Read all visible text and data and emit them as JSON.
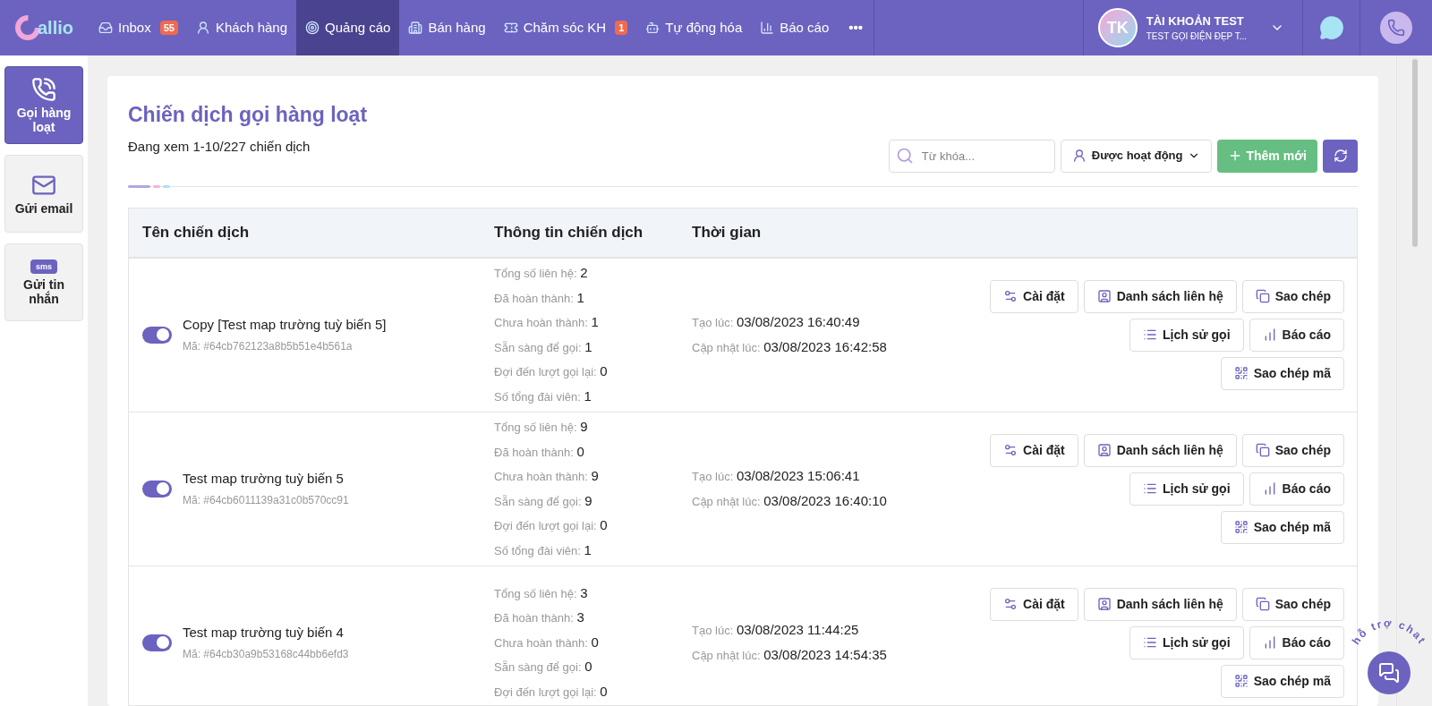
{
  "nav": {
    "logo": "allio",
    "items": [
      {
        "label": "Inbox",
        "badge": "55",
        "selected": false
      },
      {
        "label": "Khách hàng",
        "selected": false
      },
      {
        "label": "Quảng cáo",
        "selected": true
      },
      {
        "label": "Bán hàng",
        "selected": false
      },
      {
        "label": "Chăm sóc KH",
        "badge": "1",
        "selected": false
      },
      {
        "label": "Tự động hóa",
        "selected": false
      },
      {
        "label": "Báo cáo",
        "selected": false
      }
    ],
    "more": "•••",
    "account": {
      "initials": "TK",
      "name": "TÀI KHOẢN TEST",
      "subtitle": "TEST GỌI ĐIỆN ĐẸP T..."
    }
  },
  "sidebar": {
    "items": [
      {
        "label": "Gọi hàng loạt",
        "selected": true
      },
      {
        "label": "Gửi email",
        "selected": false
      },
      {
        "label": "Gửi tin nhắn",
        "selected": false,
        "icon_text": "sms"
      }
    ]
  },
  "page": {
    "title": "Chiến dịch gọi hàng loạt",
    "summary": "Đang xem 1-10/227 chiến dịch",
    "search": {
      "placeholder": "Từ khóa..."
    },
    "filter": "Được hoạt động",
    "add_button": "Thêm mới"
  },
  "table": {
    "columns": [
      "Tên chiến dịch",
      "Thông tin chiến dịch",
      "Thời gian"
    ],
    "rows": [
      {
        "on": true,
        "name": "Copy [Test map trường tuỳ biến 5]",
        "code": "Mã: #64cb762123a8b5b51e4b561a",
        "info": [
          {
            "label": "Tổng số liên hệ:",
            "value": "2"
          },
          {
            "label": "Đã hoàn thành:",
            "value": "1"
          },
          {
            "label": "Chưa hoàn thành:",
            "value": "1"
          },
          {
            "label": "Sẵn sàng để gọi:",
            "value": "1"
          },
          {
            "label": "Đợi đến lượt gọi lại:",
            "value": "0"
          },
          {
            "label": "Số tổng đài viên:",
            "value": "1"
          }
        ],
        "times": [
          {
            "label": "Tạo lúc:",
            "value": "03/08/2023 16:40:49"
          },
          {
            "label": "Cập nhật lúc:",
            "value": "03/08/2023 16:42:58"
          }
        ],
        "actions": [
          "Cài đặt",
          "Danh sách liên hệ",
          "Sao chép",
          "Lịch sử gọi",
          "Báo cáo",
          "Sao chép mã"
        ]
      },
      {
        "on": true,
        "name": "Test map trường tuỳ biến 5",
        "code": "Mã: #64cb6011139a31c0b570cc91",
        "info": [
          {
            "label": "Tổng số liên hệ:",
            "value": "9"
          },
          {
            "label": "Đã hoàn thành:",
            "value": "0"
          },
          {
            "label": "Chưa hoàn thành:",
            "value": "9"
          },
          {
            "label": "Sẵn sàng để gọi:",
            "value": "9"
          },
          {
            "label": "Đợi đến lượt gọi lại:",
            "value": "0"
          },
          {
            "label": "Số tổng đài viên:",
            "value": "1"
          }
        ],
        "times": [
          {
            "label": "Tạo lúc:",
            "value": "03/08/2023 15:06:41"
          },
          {
            "label": "Cập nhật lúc:",
            "value": "03/08/2023 16:40:10"
          }
        ],
        "actions": [
          "Cài đặt",
          "Danh sách liên hệ",
          "Sao chép",
          "Lịch sử gọi",
          "Báo cáo",
          "Sao chép mã"
        ]
      },
      {
        "on": true,
        "name": "Test map trường tuỳ biến 4",
        "code": "Mã: #64cb30a9b53168c44bb6efd3",
        "info": [
          {
            "label": "Tổng số liên hệ:",
            "value": "3"
          },
          {
            "label": "Đã hoàn thành:",
            "value": "3"
          },
          {
            "label": "Chưa hoàn thành:",
            "value": "0"
          },
          {
            "label": "Sẵn sàng để gọi:",
            "value": "0"
          },
          {
            "label": "Đợi đến lượt gọi lại:",
            "value": "0"
          }
        ],
        "times": [
          {
            "label": "Tạo lúc:",
            "value": "03/08/2023 11:44:25"
          },
          {
            "label": "Cập nhật lúc:",
            "value": "03/08/2023 14:54:35"
          }
        ],
        "actions": [
          "Cài đặt",
          "Danh sách liên hệ",
          "Sao chép",
          "Lịch sử gọi",
          "Báo cáo",
          "Sao chép mã"
        ]
      }
    ]
  },
  "chat_widget": {
    "label": "hỗ trợ chat"
  }
}
